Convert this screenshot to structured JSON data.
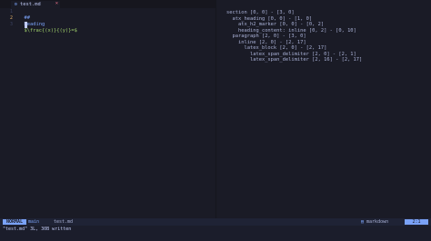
{
  "tab": {
    "icon": "markdown-file-icon",
    "name": "test.md",
    "close": "×"
  },
  "editor": {
    "lines": [
      {
        "number": "1",
        "marker": "##",
        "text": "Heading"
      },
      {
        "number": "2",
        "text": ""
      },
      {
        "number": "3",
        "text": "$\\frac{(x)}{(y)}=$"
      }
    ]
  },
  "tree": [
    "section [0, 0] - [3, 0]",
    "  atx_heading [0, 0] - [1, 0]",
    "    atx_h2_marker [0, 0] - [0, 2]",
    "    heading_content: inline [0, 2] - [0, 10]",
    "  paragraph [2, 0] - [3, 0]",
    "    inline [2, 0] - [2, 17]",
    "      latex_block [2, 0] - [2, 17]",
    "        latex_span_delimiter [2, 0] - [2, 1]",
    "        latex_span_delimiter [2, 16] - [2, 17]"
  ],
  "status": {
    "mode": "NORMAL",
    "branch": "main",
    "file": "test.md",
    "filetype": "markdown",
    "position": "2:1"
  },
  "cmdline": "\"test.md\" 3L, 30B written",
  "colors": {
    "accent": "#7aa2f7",
    "bg": "#1a1b26",
    "fg": "#c0caf5"
  }
}
